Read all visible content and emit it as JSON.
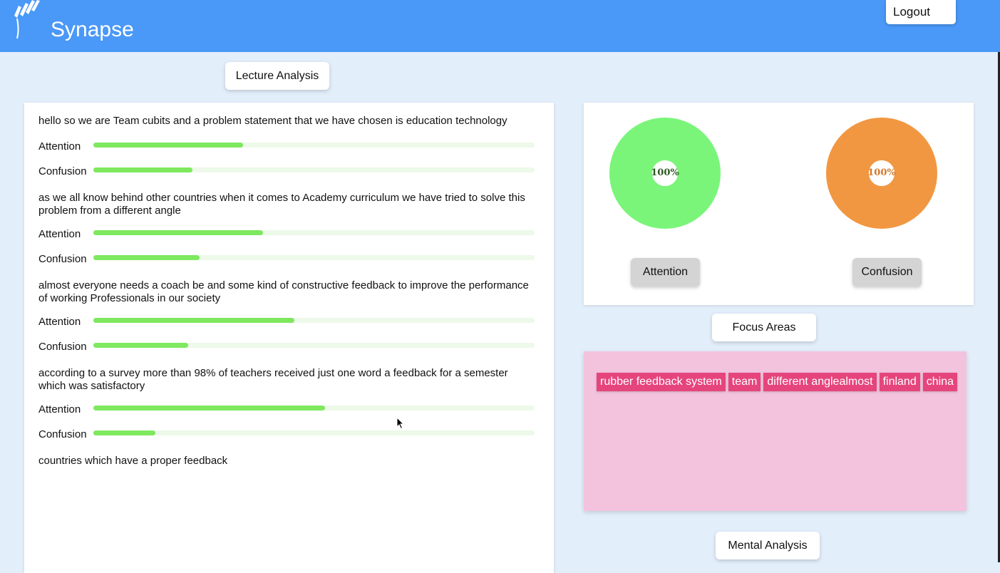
{
  "header": {
    "brand": "Synapse",
    "logout_label": "Logout"
  },
  "lecture": {
    "title_button": "Lecture Analysis",
    "segments": [
      {
        "text": "hello so we are Team cubits and a problem statement that we have chosen is education technology",
        "attention_label": "Attention",
        "attention": 34,
        "confusion_label": "Confusion",
        "confusion": 22.5
      },
      {
        "text": "as we all know behind other countries when it comes to Academy curriculum we have tried to solve this problem from a different angle",
        "attention_label": "Attention",
        "attention": 38.5,
        "confusion_label": "Confusion",
        "confusion": 24
      },
      {
        "text": "almost everyone needs a coach be and some kind of constructive feedback to improve the performance of working Professionals in our society",
        "attention_label": "Attention",
        "attention": 45.5,
        "confusion_label": "Confusion",
        "confusion": 21.5
      },
      {
        "text": "according to a survey more than 98% of teachers received just one word a feedback for a semester which was satisfactory",
        "attention_label": "Attention",
        "attention": 52.5,
        "confusion_label": "Confusion",
        "confusion": 14
      }
    ],
    "trailing_text": "countries which have a proper feedback"
  },
  "summary": {
    "attention": {
      "value": 100,
      "label": "100%",
      "legend": "Attention",
      "color": "#7af57a",
      "text_color": "#2c5a20"
    },
    "confusion": {
      "value": 100,
      "label": "100%",
      "legend": "Confusion",
      "color": "#f19742",
      "text_color": "#d2782a"
    }
  },
  "focus": {
    "title_button": "Focus Areas",
    "tags": [
      "rubber feedback system",
      "team",
      "different anglealmost",
      "finland",
      "china"
    ]
  },
  "mental": {
    "title_button": "Mental Analysis"
  },
  "colors": {
    "header": "#4a98f7",
    "bar": "#7ee85f",
    "tag": "#e5457c",
    "focus_bg": "#f3c3de"
  }
}
